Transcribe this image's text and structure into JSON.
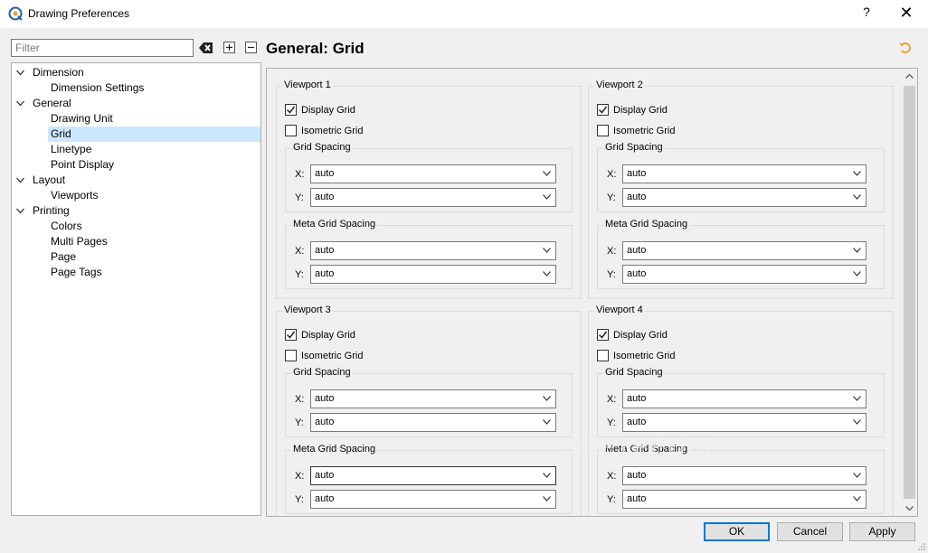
{
  "window": {
    "title": "Drawing Preferences",
    "help": "?",
    "close": "✕"
  },
  "filter": {
    "placeholder": "Filter"
  },
  "tree": {
    "items": [
      {
        "label": "Dimension",
        "level": 0,
        "expanded": true
      },
      {
        "label": "Dimension Settings",
        "level": 1
      },
      {
        "label": "General",
        "level": 0,
        "expanded": true
      },
      {
        "label": "Drawing Unit",
        "level": 1
      },
      {
        "label": "Grid",
        "level": 1,
        "selected": true
      },
      {
        "label": "Linetype",
        "level": 1
      },
      {
        "label": "Point Display",
        "level": 1
      },
      {
        "label": "Layout",
        "level": 0,
        "expanded": true
      },
      {
        "label": "Viewports",
        "level": 1
      },
      {
        "label": "Printing",
        "level": 0,
        "expanded": true
      },
      {
        "label": "Colors",
        "level": 1
      },
      {
        "label": "Multi Pages",
        "level": 1
      },
      {
        "label": "Page",
        "level": 1
      },
      {
        "label": "Page Tags",
        "level": 1
      }
    ]
  },
  "page_title": "General: Grid",
  "viewports": [
    {
      "title": "Viewport 1",
      "display_grid": {
        "label": "Display Grid",
        "checked": true
      },
      "isometric_grid": {
        "label": "Isometric Grid",
        "checked": false
      },
      "grid_spacing": {
        "title": "Grid Spacing",
        "x_label": "X:",
        "x": "auto",
        "y_label": "Y:",
        "y": "auto"
      },
      "meta_grid_spacing": {
        "title": "Meta Grid Spacing",
        "x_label": "X:",
        "x": "auto",
        "y_label": "Y:",
        "y": "auto"
      }
    },
    {
      "title": "Viewport 2",
      "display_grid": {
        "label": "Display Grid",
        "checked": true
      },
      "isometric_grid": {
        "label": "Isometric Grid",
        "checked": false
      },
      "grid_spacing": {
        "title": "Grid Spacing",
        "x_label": "X:",
        "x": "auto",
        "y_label": "Y:",
        "y": "auto"
      },
      "meta_grid_spacing": {
        "title": "Meta Grid Spacing",
        "x_label": "X:",
        "x": "auto",
        "y_label": "Y:",
        "y": "auto"
      }
    },
    {
      "title": "Viewport 3",
      "display_grid": {
        "label": "Display Grid",
        "checked": true
      },
      "isometric_grid": {
        "label": "Isometric Grid",
        "checked": false
      },
      "grid_spacing": {
        "title": "Grid Spacing",
        "x_label": "X:",
        "x": "auto",
        "y_label": "Y:",
        "y": "auto"
      },
      "meta_grid_spacing": {
        "title": "Meta Grid Spacing",
        "x_label": "X:",
        "x": "auto",
        "y_label": "Y:",
        "y": "auto"
      }
    },
    {
      "title": "Viewport 4",
      "display_grid": {
        "label": "Display Grid",
        "checked": true
      },
      "isometric_grid": {
        "label": "Isometric Grid",
        "checked": false
      },
      "grid_spacing": {
        "title": "Grid Spacing",
        "x_label": "X:",
        "x": "auto",
        "y_label": "Y:",
        "y": "auto"
      },
      "meta_grid_spacing": {
        "title": "Meta Grid Spacing",
        "x_label": "X:",
        "x": "auto",
        "y_label": "Y:",
        "y": "auto"
      }
    }
  ],
  "buttons": {
    "ok": "OK",
    "cancel": "Cancel",
    "apply": "Apply"
  },
  "watermark": "SOFTPEDIA",
  "colors": {
    "accent": "#0078d7",
    "selection": "#cce8ff",
    "reset_icon": "#e8a33c"
  }
}
